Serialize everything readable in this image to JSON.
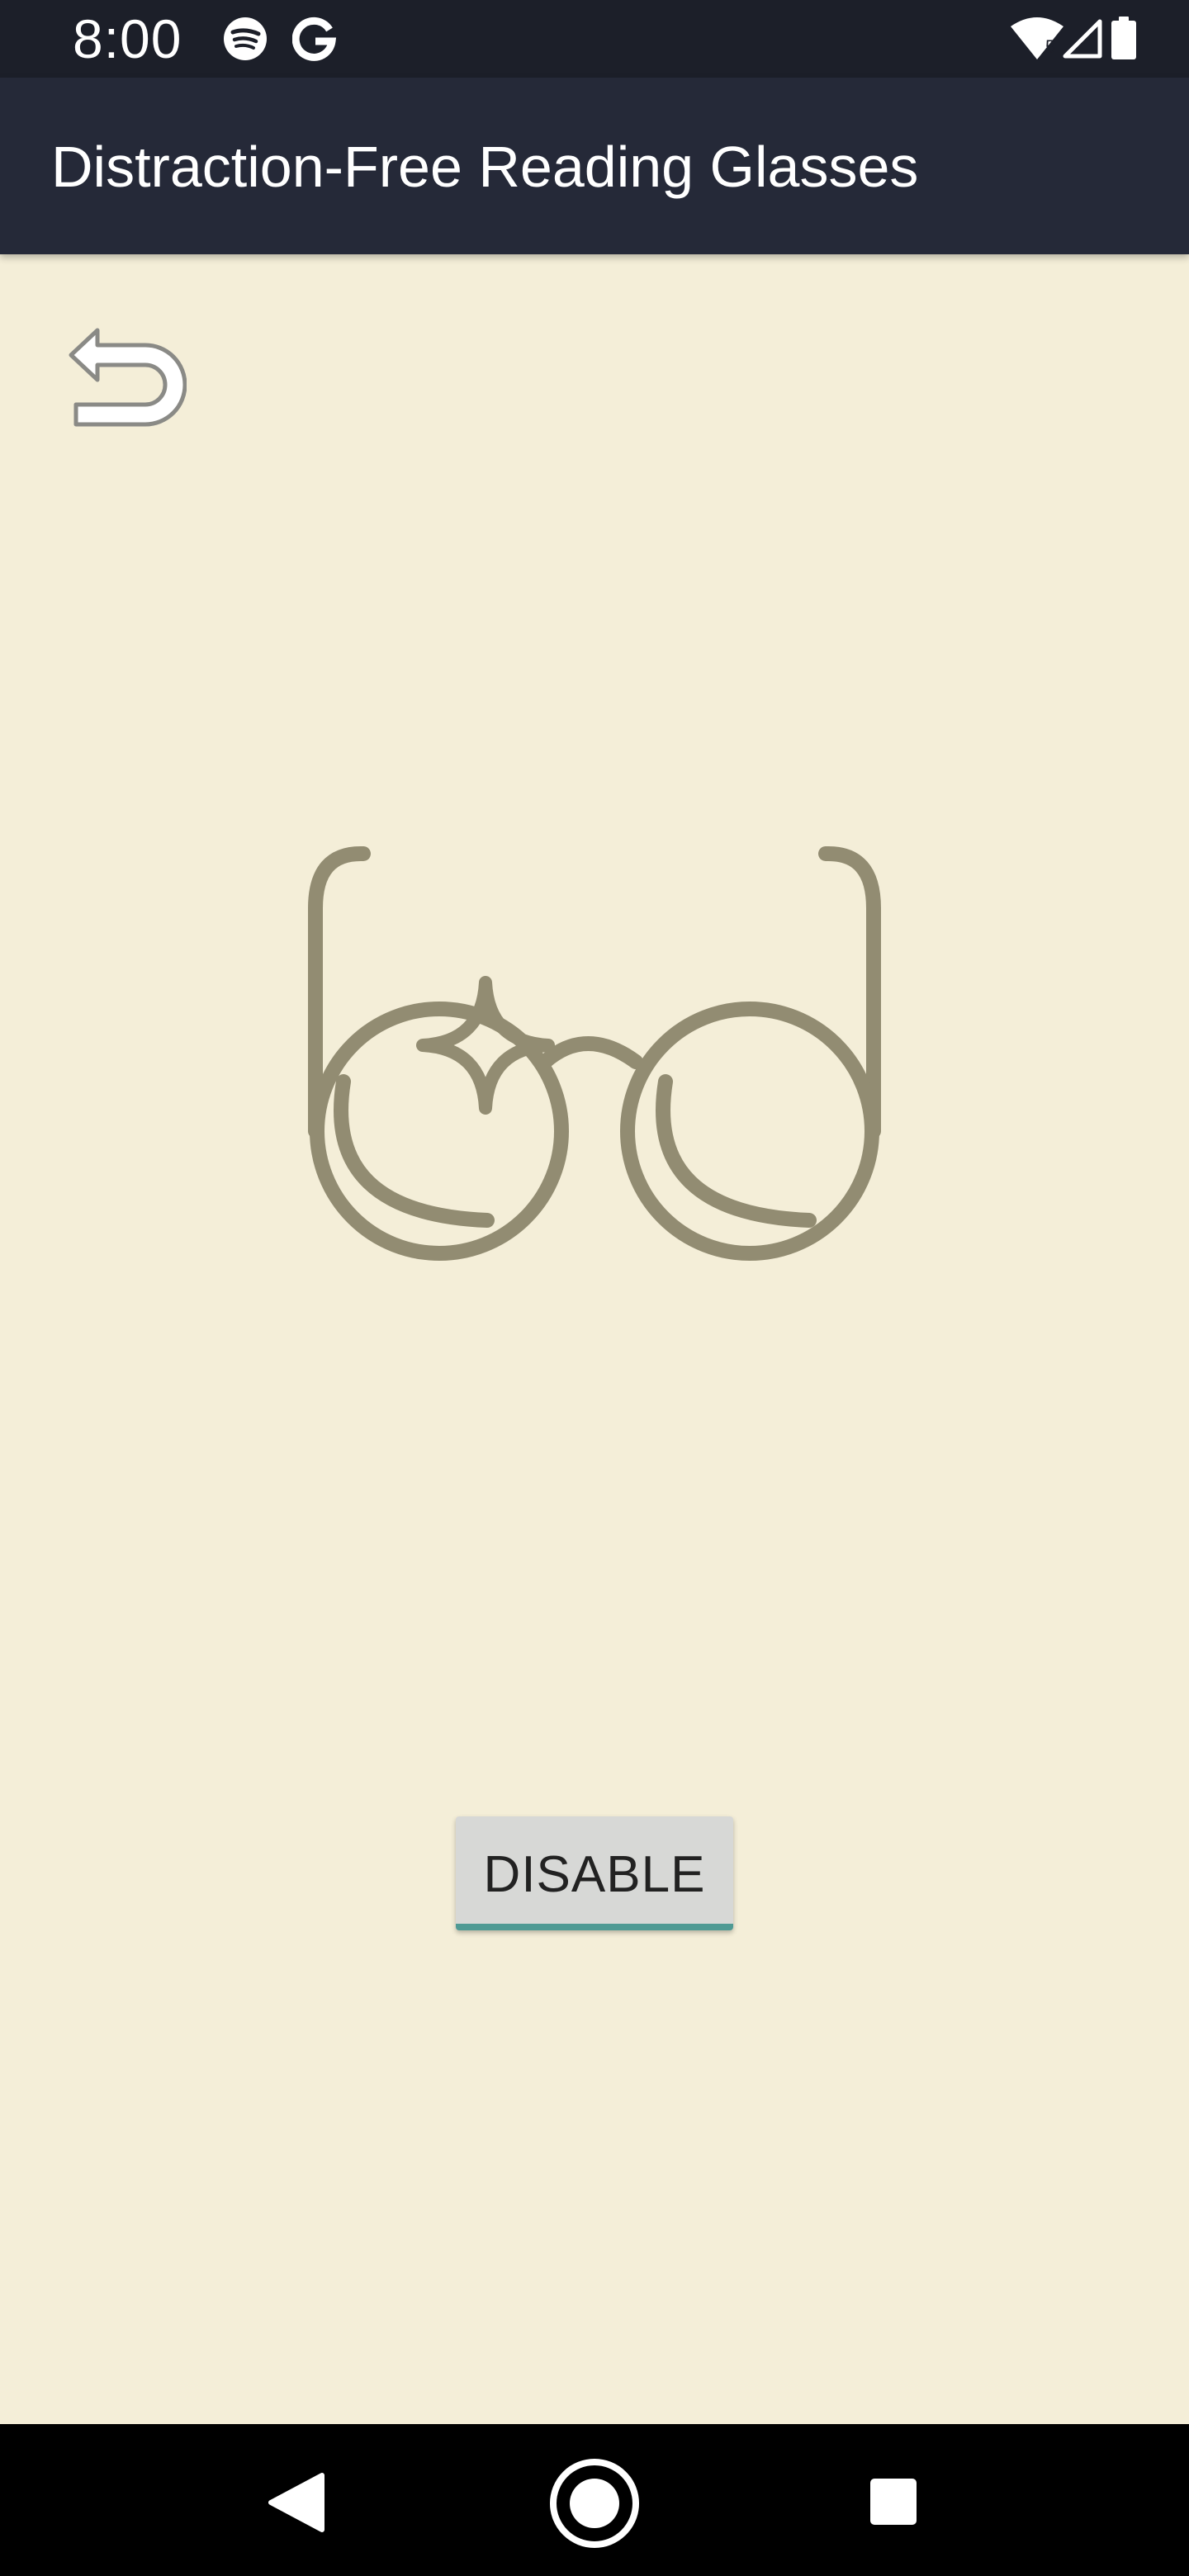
{
  "status_bar": {
    "time": "8:00",
    "icons": [
      "spotify-icon",
      "google-icon",
      "wifi-icon",
      "signal-icon",
      "battery-icon"
    ],
    "wifi_badge": "5"
  },
  "app_bar": {
    "title": "Distraction-Free Reading Glasses"
  },
  "content": {
    "back_icon": "undo-arrow-icon",
    "illustration_icon": "glasses-icon",
    "illustration_color": "#928c72",
    "disable_button_label": "DISABLE",
    "accent_color": "#4f9a94"
  },
  "nav_bar": {
    "buttons": [
      "back",
      "home",
      "recents"
    ]
  },
  "colors": {
    "background": "#f4eed8",
    "status_bar": "#1c1f29",
    "app_bar": "#252938"
  }
}
